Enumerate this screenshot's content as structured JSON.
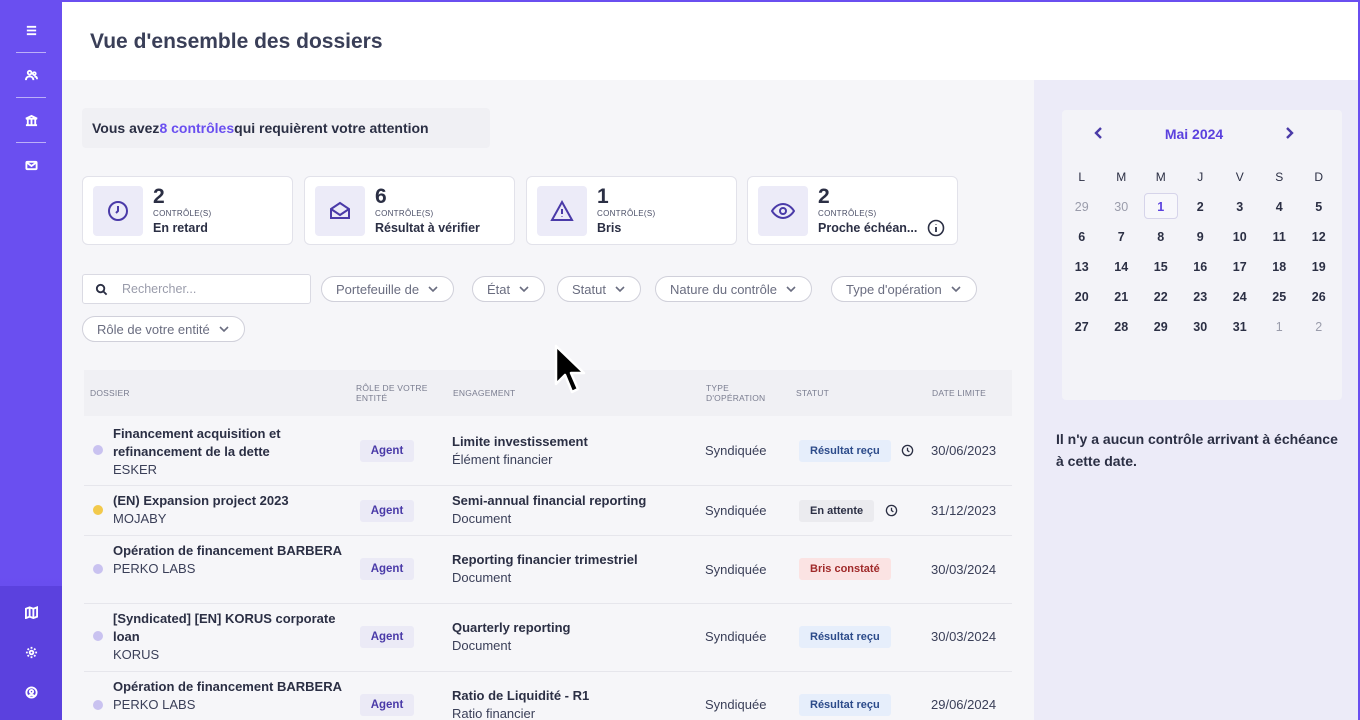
{
  "header": {
    "title": "Vue d'ensemble des dossiers"
  },
  "attention": {
    "prefix": "Vous avez ",
    "highlight": "8 contrôles",
    "suffix": " qui requièrent votre attention"
  },
  "stats": [
    {
      "count": "2",
      "sub": "CONTRÔLE(S)",
      "label": "En retard",
      "icon": "clock-icon"
    },
    {
      "count": "6",
      "sub": "CONTRÔLE(S)",
      "label": "Résultat à vérifier",
      "icon": "envelope-open-icon"
    },
    {
      "count": "1",
      "sub": "CONTRÔLE(S)",
      "label": "Bris",
      "icon": "warning-icon"
    },
    {
      "count": "2",
      "sub": "CONTRÔLE(S)",
      "label": "Proche échéan...",
      "icon": "eye-icon"
    }
  ],
  "search": {
    "placeholder": "Rechercher..."
  },
  "filters": [
    "Portefeuille de",
    "État",
    "Statut",
    "Nature du contrôle",
    "Type d'opération",
    "Rôle de votre entité"
  ],
  "table": {
    "columns": [
      "DOSSIER",
      "RÔLE DE VOTRE ENTITÉ",
      "ENGAGEMENT",
      "TYPE D'OPÉRATION",
      "STATUT",
      "DATE LIMITE"
    ],
    "rows": [
      {
        "title": "Financement acquisition et refinancement de la dette",
        "client": "ESKER",
        "role": "Agent",
        "engagement": "Limite investissement",
        "eng_type": "Élément financier",
        "type": "Syndiquée",
        "status": "Résultat reçu",
        "date": "30/06/2023"
      },
      {
        "title": "(EN) Expansion project 2023",
        "client": "MOJABY",
        "role": "Agent",
        "engagement": "Semi-annual financial reporting",
        "eng_type": "Document",
        "type": "Syndiquée",
        "status": "En attente",
        "date": "31/12/2023"
      },
      {
        "title": "Opération de financement BARBERA",
        "client": "PERKO LABS",
        "role": "Agent",
        "engagement": "Reporting financier trimestriel",
        "eng_type": "Document",
        "type": "Syndiquée",
        "status": "Bris constaté",
        "date": "30/03/2024"
      },
      {
        "title": "[Syndicated] [EN] KORUS corporate loan",
        "client": "KORUS",
        "role": "Agent",
        "engagement": "Quarterly reporting",
        "eng_type": "Document",
        "type": "Syndiquée",
        "status": "Résultat reçu",
        "date": "30/03/2024"
      },
      {
        "title": "Opération de financement BARBERA",
        "client": "PERKO LABS",
        "role": "Agent",
        "engagement": "Ratio de Liquidité - R1",
        "eng_type": "Ratio financier",
        "type": "Syndiquée",
        "status": "Résultat reçu",
        "date": "29/06/2024"
      }
    ]
  },
  "calendar": {
    "month": "Mai 2024",
    "weekdays": [
      "L",
      "M",
      "M",
      "J",
      "V",
      "S",
      "D"
    ],
    "days": [
      [
        "29",
        "30",
        "1",
        "2",
        "3",
        "4",
        "5"
      ],
      [
        "6",
        "7",
        "8",
        "9",
        "10",
        "11",
        "12"
      ],
      [
        "13",
        "14",
        "15",
        "16",
        "17",
        "18",
        "19"
      ],
      [
        "20",
        "21",
        "22",
        "23",
        "24",
        "25",
        "26"
      ],
      [
        "27",
        "28",
        "29",
        "30",
        "31",
        "1",
        "2"
      ]
    ]
  },
  "empty_message": "Il n'y a aucun contrôle arrivant à échéance à cette date.",
  "colors": {
    "accent": "#6a4ff0",
    "status_received": "#e6eefb",
    "status_pending": "#ebebef",
    "status_breach": "#fbe3e3"
  }
}
